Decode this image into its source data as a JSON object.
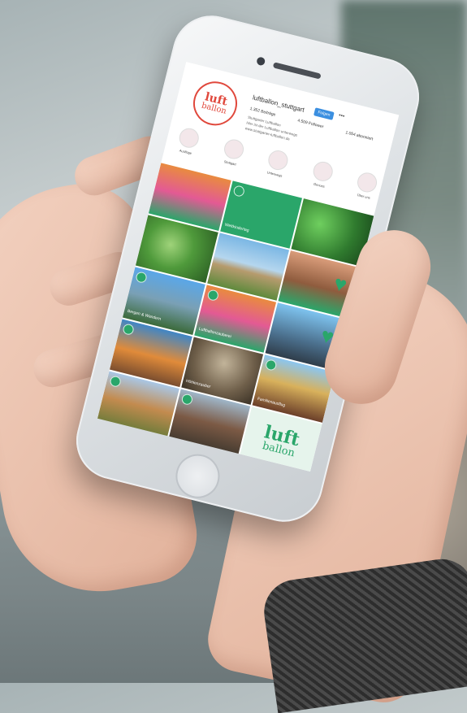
{
  "profile": {
    "username": "luftballon_stuttgart",
    "follow_label": "Folgen",
    "stats": [
      "1.352 Beiträge",
      "4.509 Follower",
      "1.054 abonniert"
    ],
    "bio": [
      "Stuttgarter Luftballon",
      "Hier ist der Luftballon unterwegs",
      "www.stuttgarter-luftballon.de"
    ],
    "highlights": [
      "Ausflüge",
      "Stuttgart",
      "Unterwegs",
      "Genuss",
      "Über uns"
    ]
  },
  "grid": [
    {
      "caption": ""
    },
    {
      "caption": "Weltkindertag"
    },
    {
      "caption": ""
    },
    {
      "caption": ""
    },
    {
      "caption": ""
    },
    {
      "caption": ""
    },
    {
      "caption": "Bergen & Wandern"
    },
    {
      "caption": "Luftballonzauberei"
    },
    {
      "caption": ""
    },
    {
      "caption": ""
    },
    {
      "caption": "Höhlenzauber"
    },
    {
      "caption": "Familienausflug"
    },
    {
      "caption": ""
    },
    {
      "caption": ""
    },
    {
      "caption": ""
    }
  ],
  "logo": {
    "line1": "luft",
    "line2": "ballon"
  },
  "colors": {
    "brand_green": "#2aa66a",
    "brand_red": "#e0483c"
  }
}
